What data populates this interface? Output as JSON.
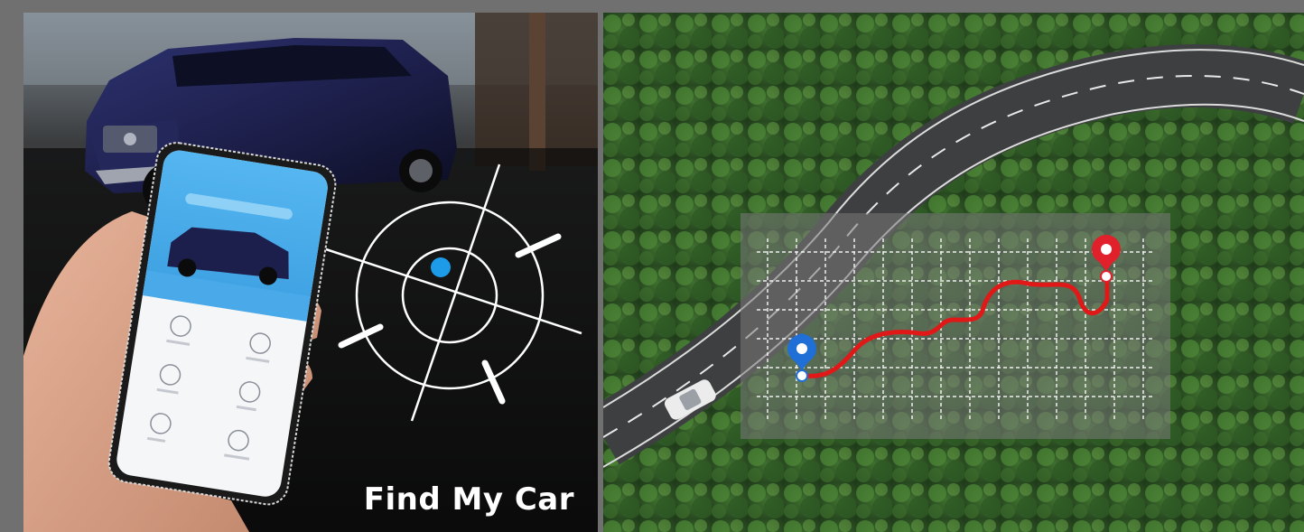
{
  "banner": {
    "caption": "Find My Car"
  },
  "colors": {
    "location_dot": "#1e9be8",
    "route_line": "#e01818",
    "start_pin": "#1f6fd6",
    "end_pin": "#e0202a",
    "grid_line": "#ffffff"
  },
  "icons": {
    "target": "crosshair-target-icon",
    "start": "map-pin-start-icon",
    "end": "map-pin-end-icon"
  }
}
